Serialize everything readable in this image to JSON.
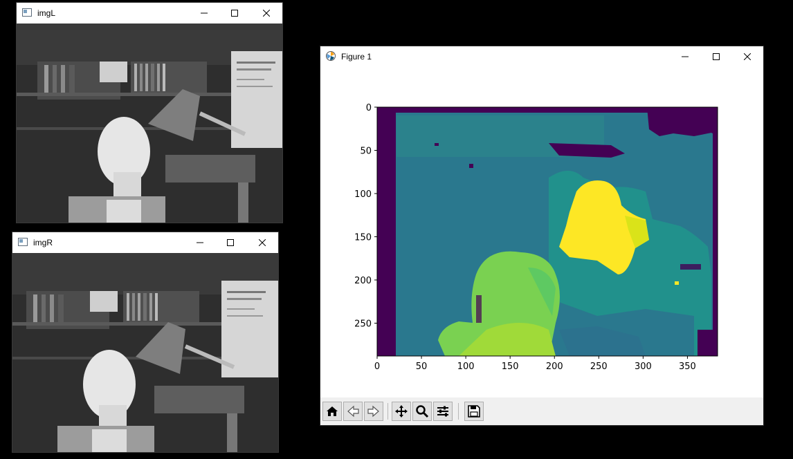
{
  "windows": {
    "imgL": {
      "title": "imgL"
    },
    "imgR": {
      "title": "imgR"
    },
    "figure": {
      "title": "Figure 1"
    }
  },
  "figure_axes": {
    "x_ticks": [
      "0",
      "50",
      "100",
      "150",
      "200",
      "250",
      "300",
      "350"
    ],
    "y_ticks": [
      "0",
      "50",
      "100",
      "150",
      "200",
      "250"
    ],
    "xlim": [
      0,
      384
    ],
    "ylim": [
      0,
      288
    ],
    "colormap": "viridis"
  },
  "toolbar": {
    "buttons": [
      {
        "name": "home-button",
        "icon": "home-icon"
      },
      {
        "name": "back-button",
        "icon": "back-arrow-icon"
      },
      {
        "name": "forward-button",
        "icon": "forward-arrow-icon"
      },
      {
        "name": "pan-button",
        "icon": "move-icon"
      },
      {
        "name": "zoom-button",
        "icon": "magnifier-icon"
      },
      {
        "name": "configure-subplots-button",
        "icon": "sliders-icon"
      },
      {
        "name": "save-button",
        "icon": "floppy-disk-icon"
      }
    ]
  },
  "colors": {
    "viridis_dark": "#440154",
    "viridis_teal": "#2a788e",
    "viridis_green": "#5ec962",
    "viridis_yellow": "#fde725"
  }
}
